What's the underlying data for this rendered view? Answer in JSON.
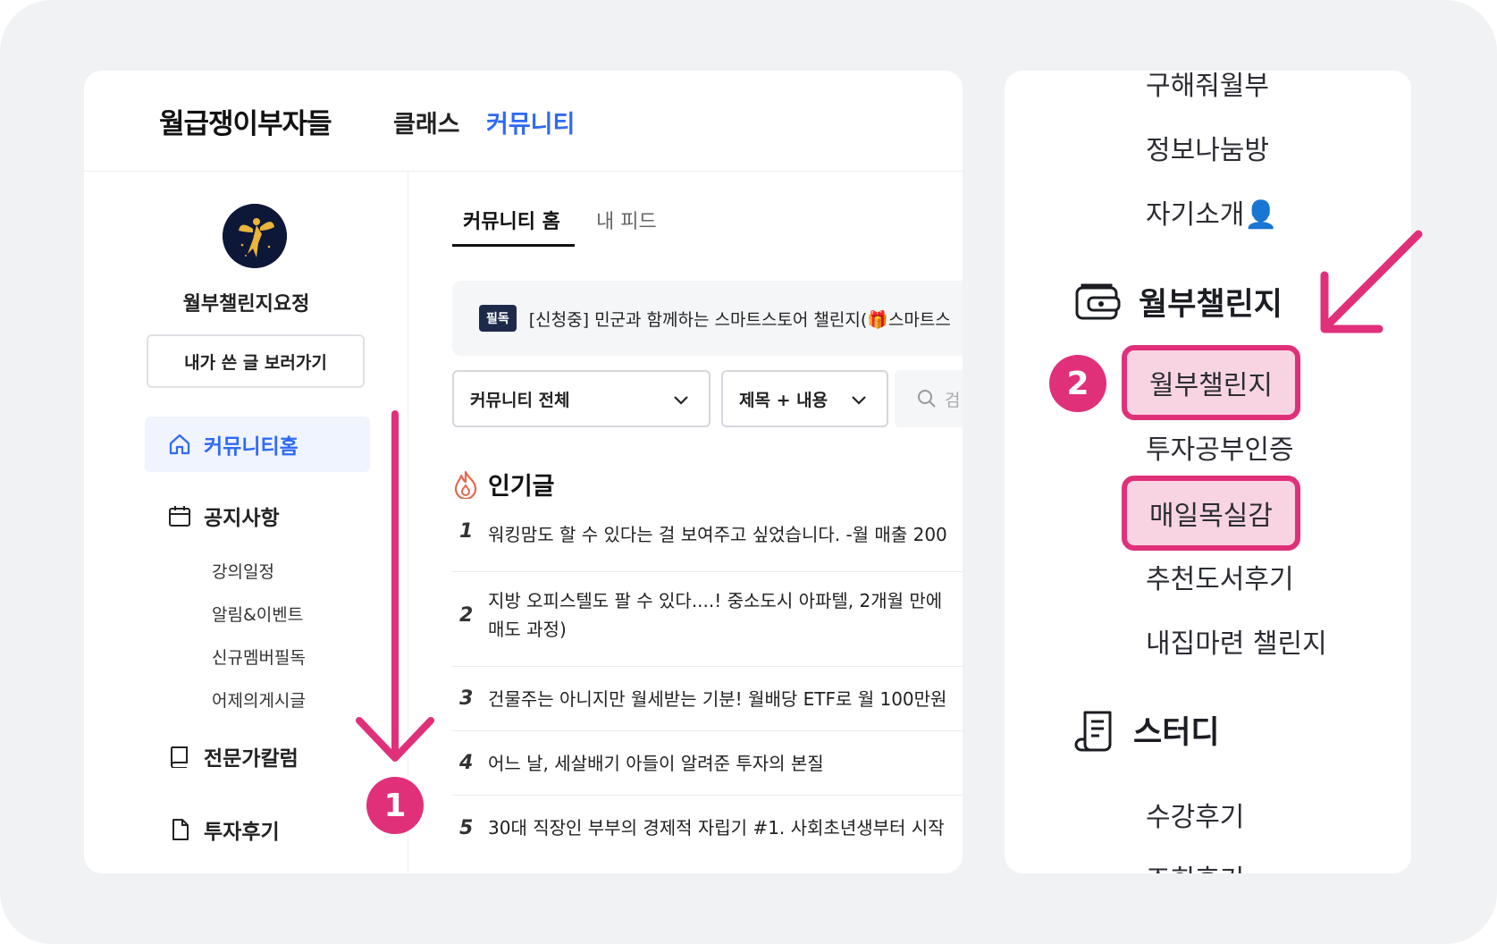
{
  "header": {
    "brand": "월급쟁이부자들",
    "nav": [
      "클래스",
      "커뮤니티"
    ]
  },
  "sidebar": {
    "nickname": "월부챌린지요정",
    "my_posts_button": "내가 쓴 글 보러가기",
    "home": "커뮤니티홈",
    "notice": "공지사항",
    "notice_items": [
      "강의일정",
      "알림&이벤트",
      "신규멤버필독",
      "어제의게시글"
    ],
    "column": "전문가칼럼",
    "review": "투자후기"
  },
  "content": {
    "tabs": [
      "커뮤니티 홈",
      "내 피드"
    ],
    "pinned_badge": "필독",
    "pinned_text": "[신청중] 민군과 함께하는 스마트스토어 챌린지(🎁스마트스",
    "filter_scope": "커뮤니티 전체",
    "filter_field": "제목 + 내용",
    "search_placeholder": "검",
    "popular_title": "인기글",
    "posts": [
      {
        "num": "1",
        "title": "워킹맘도 할 수 있다는 걸 보여주고 싶었습니다. -월 매출 200"
      },
      {
        "num": "2",
        "title": "지방 오피스텔도 팔 수 있다....! 중소도시 아파텔, 2개월 만에",
        "title2": "매도 과정)"
      },
      {
        "num": "3",
        "title": "건물주는 아니지만 월세받는 기분! 월배당 ETF로 월 100만원"
      },
      {
        "num": "4",
        "title": "어느 날, 세살배기 아들이 알려준 투자의 본질"
      },
      {
        "num": "5",
        "title": "30대 직장인 부부의 경제적 자립기 #1. 사회초년생부터 시작"
      }
    ]
  },
  "right_panel": {
    "items_top": [
      "구해줘월부",
      "정보나눔방",
      "자기소개👤"
    ],
    "challenge_header": "월부챌린지",
    "challenge_items": [
      "월부챌린지",
      "투자공부인증",
      "매일목실감",
      "추천도서후기",
      "내집마련 챌린지"
    ],
    "study_header": "스터디",
    "study_items": [
      "수강후기",
      "조회후기"
    ]
  },
  "steps": [
    "1",
    "2"
  ],
  "colors": {
    "accent": "#e0307a",
    "brand_blue": "#2f6af5",
    "highlight_fill": "#f8d4e2"
  }
}
